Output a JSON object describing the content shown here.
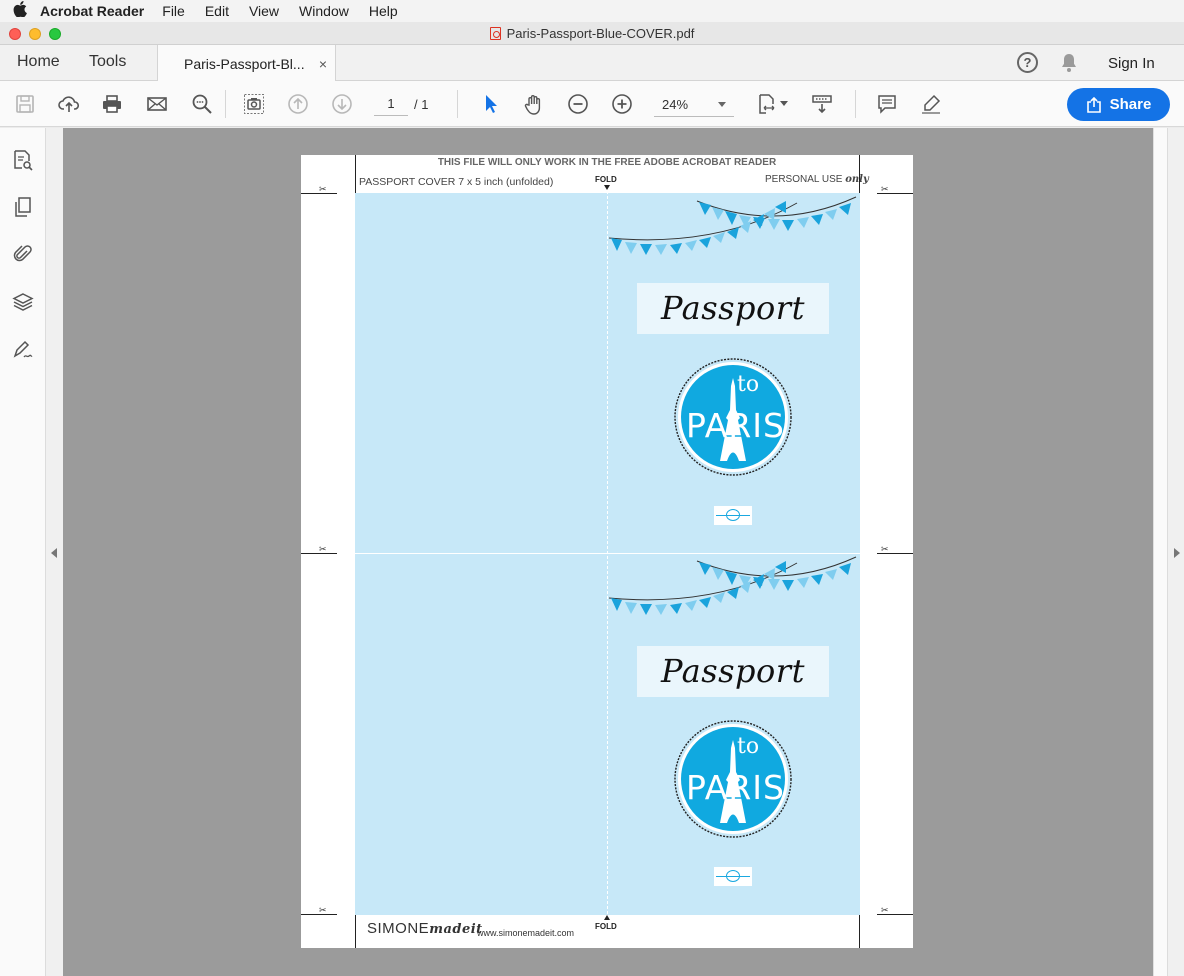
{
  "menubar": {
    "apple": "",
    "app_name": "Acrobat Reader",
    "items": [
      "File",
      "Edit",
      "View",
      "Window",
      "Help"
    ]
  },
  "window": {
    "title": "Paris-Passport-Blue-COVER.pdf"
  },
  "tabs": {
    "home": "Home",
    "tools": "Tools",
    "doc_tab": "Paris-Passport-Bl...",
    "close": "×",
    "help": "?",
    "sign_in": "Sign In"
  },
  "toolbar": {
    "page_current": "1",
    "page_total": "/ 1",
    "zoom": "24%",
    "share_label": "Share",
    "icons": [
      "save-icon",
      "upload-icon",
      "print-icon",
      "email-icon",
      "find-icon",
      "snapshot-icon",
      "prev-page-icon",
      "next-page-icon",
      "select-cursor-icon",
      "hand-icon",
      "zoom-out-icon",
      "zoom-in-icon",
      "page-fit-icon",
      "scroll-mode-icon",
      "comment-icon",
      "highlight-icon"
    ]
  },
  "left_panel": {
    "icons": [
      "page-thumbnails-icon",
      "pages-icon",
      "attachments-icon",
      "layers-icon",
      "signature-icon"
    ]
  },
  "document": {
    "header_notice": "THIS FILE WILL ONLY WORK IN THE FREE ADOBE ACROBAT READER",
    "size_label": "PASSPORT COVER 7 x 5 inch (unfolded)",
    "fold_label": "FOLD",
    "personal_use": "PERSONAL USE",
    "personal_use_script": "only",
    "passport_title": "Passport",
    "badge_to": "to",
    "badge_paris": "PARIS",
    "brand_main": "SIMONE",
    "brand_script": "madeit",
    "brand_url": "www.simonemadeit.com",
    "colors": {
      "panel_blue": "#c7e8f8",
      "badge_blue": "#10a9e0",
      "flag_light": "#7fcdef",
      "flag_dark": "#14a3dc"
    }
  }
}
